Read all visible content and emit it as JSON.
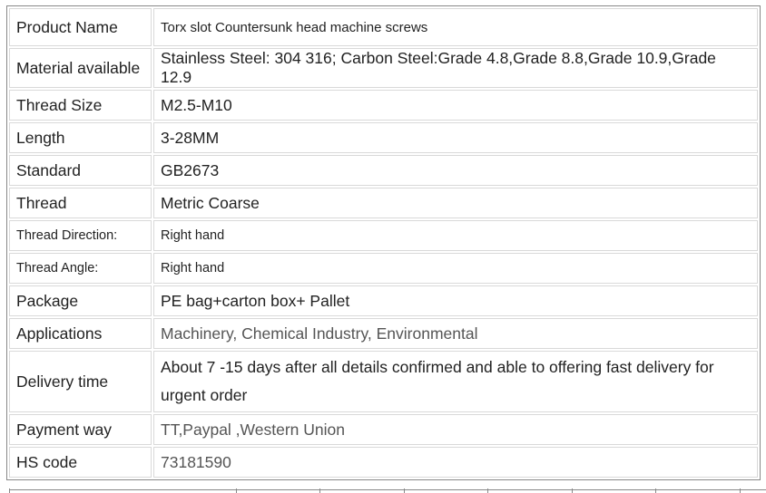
{
  "rows": [
    {
      "label": "Product Name",
      "value": "Torx slot Countersunk head machine screws"
    },
    {
      "label": "Material available",
      "value": "Stainless Steel: 304 316; Carbon Steel:Grade 4.8,Grade 8.8,Grade 10.9,Grade 12.9"
    },
    {
      "label": "Thread Size",
      "value": "M2.5-M10"
    },
    {
      "label": "Length",
      "value": "3-28MM"
    },
    {
      "label": "Standard",
      "value": "GB2673"
    },
    {
      "label": "Thread",
      "value": "Metric Coarse"
    },
    {
      "label": "Thread Direction:",
      "value": "Right hand"
    },
    {
      "label": "Thread Angle:",
      "value": "Right hand"
    },
    {
      "label": "Package",
      "value": "PE bag+carton box+ Pallet"
    },
    {
      "label": "Applications",
      "value": "Machinery, Chemical Industry, Environmental"
    },
    {
      "label": "Delivery time",
      "value": "About 7 -15 days after all details confirmed and able to offering fast delivery for urgent order"
    },
    {
      "label": "Payment way",
      "value": "TT,Paypal ,Western Union"
    },
    {
      "label": "HS code",
      "value": "73181590"
    }
  ]
}
